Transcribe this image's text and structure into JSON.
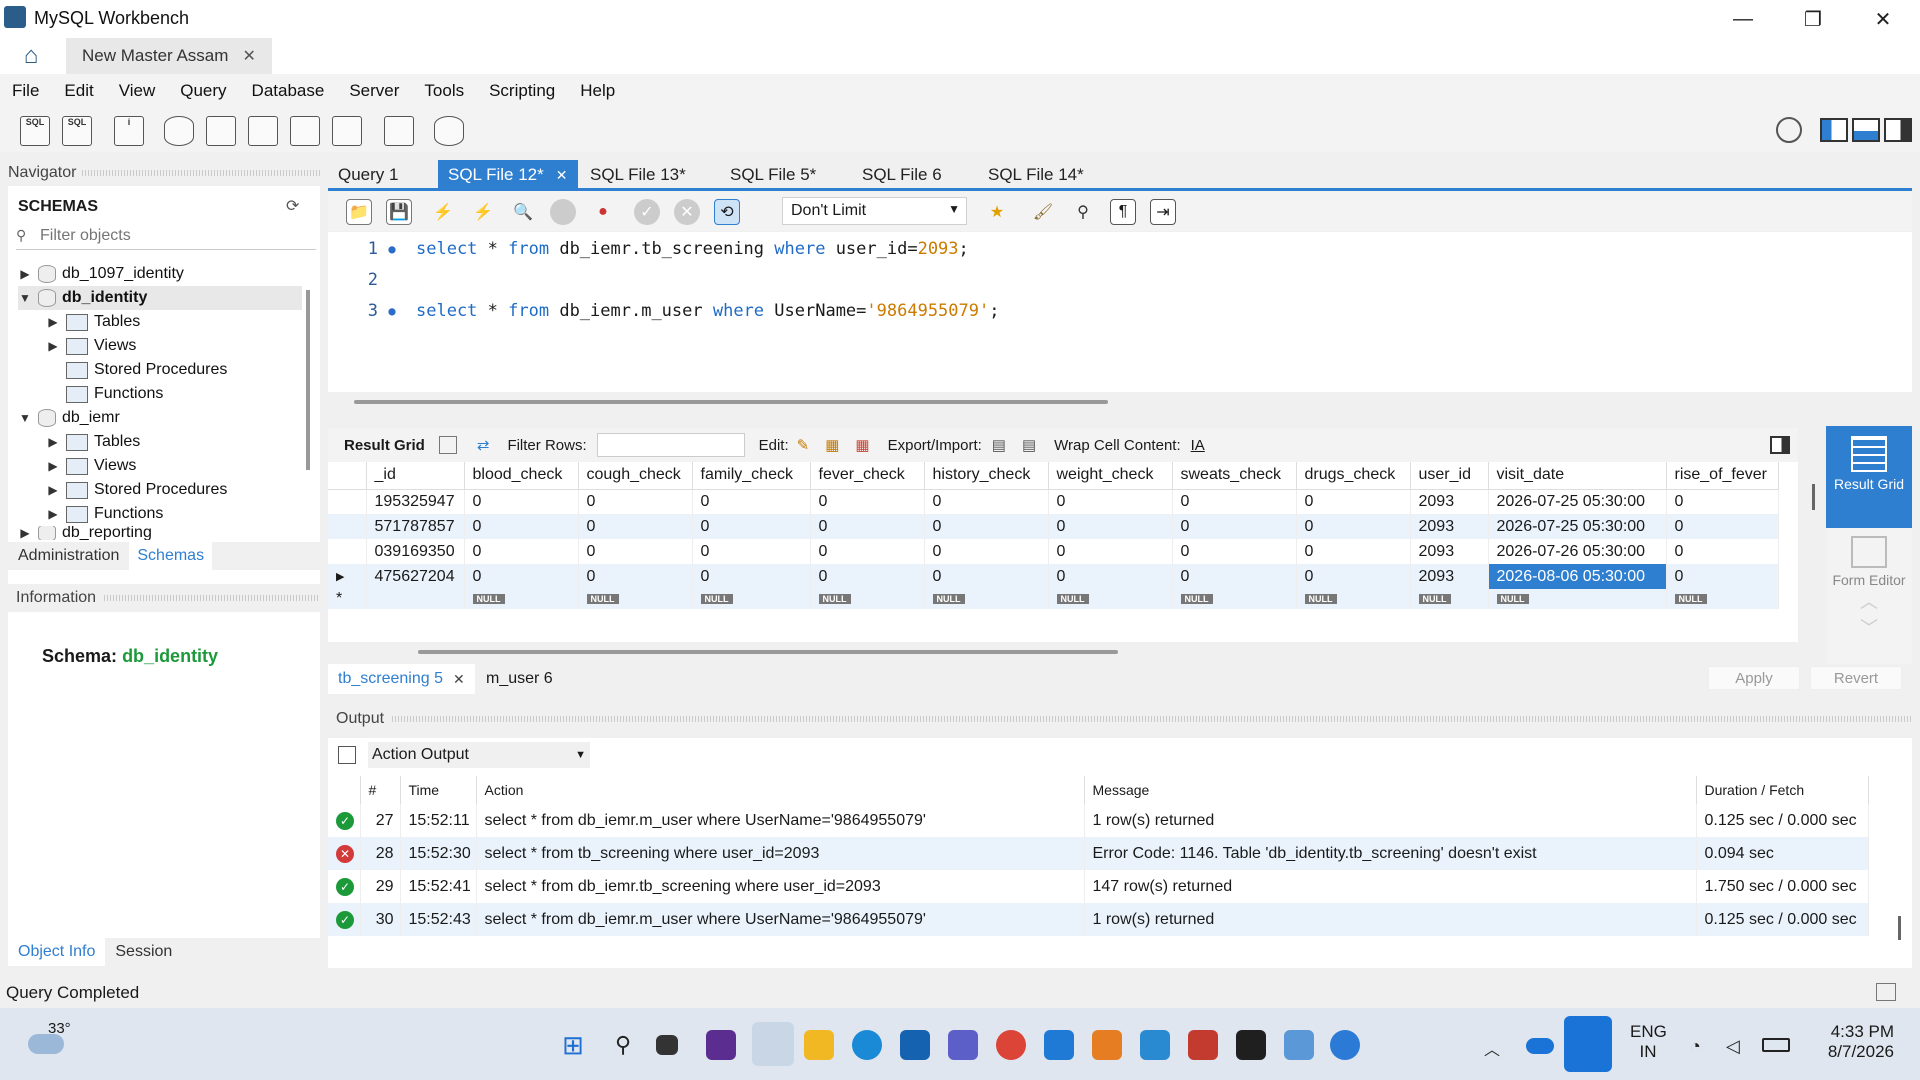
{
  "window": {
    "title": "MySQL Workbench",
    "minimize": "—",
    "restore": "❐",
    "close": "✕"
  },
  "connection_tab": {
    "label": "New Master Assam",
    "close": "✕"
  },
  "menu": [
    "File",
    "Edit",
    "View",
    "Query",
    "Database",
    "Server",
    "Tools",
    "Scripting",
    "Help"
  ],
  "navigator": {
    "title": "Navigator",
    "schemas_title": "SCHEMAS",
    "filter_placeholder": "Filter objects",
    "tree": [
      {
        "label": "db_1097_identity",
        "expanded": false,
        "bold": false
      },
      {
        "label": "db_identity",
        "expanded": true,
        "bold": true
      },
      {
        "label": "Tables"
      },
      {
        "label": "Views"
      },
      {
        "label": "Stored Procedures"
      },
      {
        "label": "Functions"
      },
      {
        "label": "db_iemr",
        "expanded": true,
        "bold": false
      },
      {
        "label": "Tables"
      },
      {
        "label": "Views"
      },
      {
        "label": "Stored Procedures"
      },
      {
        "label": "Functions"
      },
      {
        "label": "db_reporting"
      }
    ],
    "tabs": [
      "Administration",
      "Schemas"
    ],
    "info_title": "Information",
    "schema_label": "Schema:",
    "schema_value": "db_identity",
    "bottom_tabs": [
      "Object Info",
      "Session"
    ]
  },
  "editor": {
    "tabs": [
      "Query 1",
      "SQL File 12*",
      "SQL File 13*",
      "SQL File 5*",
      "SQL File 6",
      "SQL File 14*"
    ],
    "active_tab": "SQL File 12*",
    "limit": "Don't Limit",
    "lines": [
      {
        "num": "1",
        "kw1": "select",
        "mid1": " * ",
        "kw2": "from",
        "mid2": " db_iemr.tb_screening ",
        "kw3": "where",
        "mid3": " user_id=",
        "lit": "2093",
        "end": ";"
      },
      {
        "num": "2"
      },
      {
        "num": "3",
        "kw1": "select",
        "mid1": " * ",
        "kw2": "from",
        "mid2": " db_iemr.m_user ",
        "kw3": "where",
        "mid3": " UserName=",
        "lit": "'9864955079'",
        "end": ";"
      }
    ]
  },
  "result_toolbar": {
    "result_grid": "Result Grid",
    "filter_rows": "Filter Rows:",
    "edit": "Edit:",
    "export": "Export/Import:",
    "wrap": "Wrap Cell Content:"
  },
  "grid": {
    "columns": [
      "_id",
      "blood_check",
      "cough_check",
      "family_check",
      "fever_check",
      "history_check",
      "weight_check",
      "sweats_check",
      "drugs_check",
      "user_id",
      "visit_date",
      "rise_of_fever"
    ],
    "rows": [
      [
        "195325947",
        "0",
        "0",
        "0",
        "0",
        "0",
        "0",
        "0",
        "0",
        "2093",
        "2026-07-25 05:30:00",
        "0"
      ],
      [
        "571787857",
        "0",
        "0",
        "0",
        "0",
        "0",
        "0",
        "0",
        "0",
        "2093",
        "2026-07-25 05:30:00",
        "0"
      ],
      [
        "039169350",
        "0",
        "0",
        "0",
        "0",
        "0",
        "0",
        "0",
        "0",
        "2093",
        "2026-07-26 05:30:00",
        "0"
      ],
      [
        "475627204",
        "0",
        "0",
        "0",
        "0",
        "0",
        "0",
        "0",
        "0",
        "2093",
        "2026-08-06 05:30:00",
        "0"
      ]
    ],
    "null_label": "NULL"
  },
  "side": {
    "result_grid": "Result Grid",
    "form_editor": "Form Editor"
  },
  "result_tabs": [
    "tb_screening 5",
    "m_user 6"
  ],
  "apply": "Apply",
  "revert": "Revert",
  "output": {
    "title": "Output",
    "selector": "Action Output",
    "headers": [
      "#",
      "Time",
      "Action",
      "Message",
      "Duration / Fetch"
    ],
    "rows": [
      {
        "status": "ok",
        "num": "27",
        "time": "15:52:11",
        "action": "select * from db_iemr.m_user where UserName='9864955079'",
        "message": "1 row(s) returned",
        "duration": "0.125 sec / 0.000 sec"
      },
      {
        "status": "err",
        "num": "28",
        "time": "15:52:30",
        "action": "select * from tb_screening where user_id=2093",
        "message": "Error Code: 1146. Table 'db_identity.tb_screening' doesn't exist",
        "duration": "0.094 sec"
      },
      {
        "status": "ok",
        "num": "29",
        "time": "15:52:41",
        "action": "select * from db_iemr.tb_screening where user_id=2093",
        "message": "147 row(s) returned",
        "duration": "1.750 sec / 0.000 sec"
      },
      {
        "status": "ok",
        "num": "30",
        "time": "15:52:43",
        "action": "select * from db_iemr.m_user where UserName='9864955079'",
        "message": "1 row(s) returned",
        "duration": "0.125 sec / 0.000 sec"
      }
    ]
  },
  "status": "Query Completed",
  "taskbar": {
    "weather": "33°",
    "lang1": "ENG",
    "lang2": "IN",
    "time": "4:33 PM",
    "date": "8/7/2026"
  },
  "colors": {
    "accent": "#2f7fd0",
    "ok": "#1c9a3a",
    "error": "#d33a3a",
    "schema_value": "#1c9a3a"
  }
}
